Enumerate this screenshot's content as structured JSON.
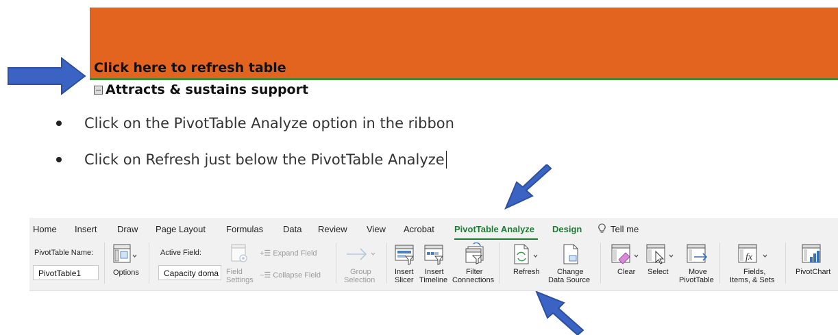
{
  "document": {
    "refresh_note": "Click here to refresh table",
    "row_label": "Attracts & sustains support",
    "bullets": [
      "Click on the PivotTable Analyze option in the ribbon",
      "Click on Refresh just below the PivotTable Analyze"
    ]
  },
  "ribbon": {
    "tabs": [
      "Home",
      "Insert",
      "Draw",
      "Page Layout",
      "Formulas",
      "Data",
      "Review",
      "View",
      "Acrobat",
      "PivotTable Analyze",
      "Design",
      "Tell me"
    ],
    "pivottable_name_label": "PivotTable Name:",
    "pivottable_name_value": "PivotTable1",
    "options_label": "Options",
    "active_field_label": "Active Field:",
    "active_field_value": "Capacity doma",
    "field_settings_1": "Field",
    "field_settings_2": "Settings",
    "expand_field": "Expand Field",
    "collapse_field": "Collapse Field",
    "group_selection_1": "Group",
    "group_selection_2": "Selection",
    "insert_slicer_1": "Insert",
    "insert_slicer_2": "Slicer",
    "insert_timeline_1": "Insert",
    "insert_timeline_2": "Timeline",
    "filter_connections_1": "Filter",
    "filter_connections_2": "Connections",
    "refresh": "Refresh",
    "change_data_source_1": "Change",
    "change_data_source_2": "Data Source",
    "clear": "Clear",
    "select": "Select",
    "move_pivottable_1": "Move",
    "move_pivottable_2": "PivotTable",
    "fields_items_sets_1": "Fields,",
    "fields_items_sets_2": "Items, & Sets",
    "pivotchart": "PivotChart"
  },
  "colors": {
    "header_orange": "#e2641f",
    "accent_green": "#1e7b34",
    "arrow_blue": "#3a63c4"
  },
  "icons": [
    "arrow-right-icon",
    "arrow-down-left-icon",
    "arrow-up-left-icon",
    "lightbulb-icon",
    "options-icon",
    "field-settings-icon",
    "group-selection-icon",
    "insert-slicer-icon",
    "insert-timeline-icon",
    "filter-connections-icon",
    "refresh-icon",
    "change-data-source-icon",
    "clear-icon",
    "select-icon",
    "move-pivottable-icon",
    "fields-items-sets-icon",
    "pivotchart-icon"
  ]
}
